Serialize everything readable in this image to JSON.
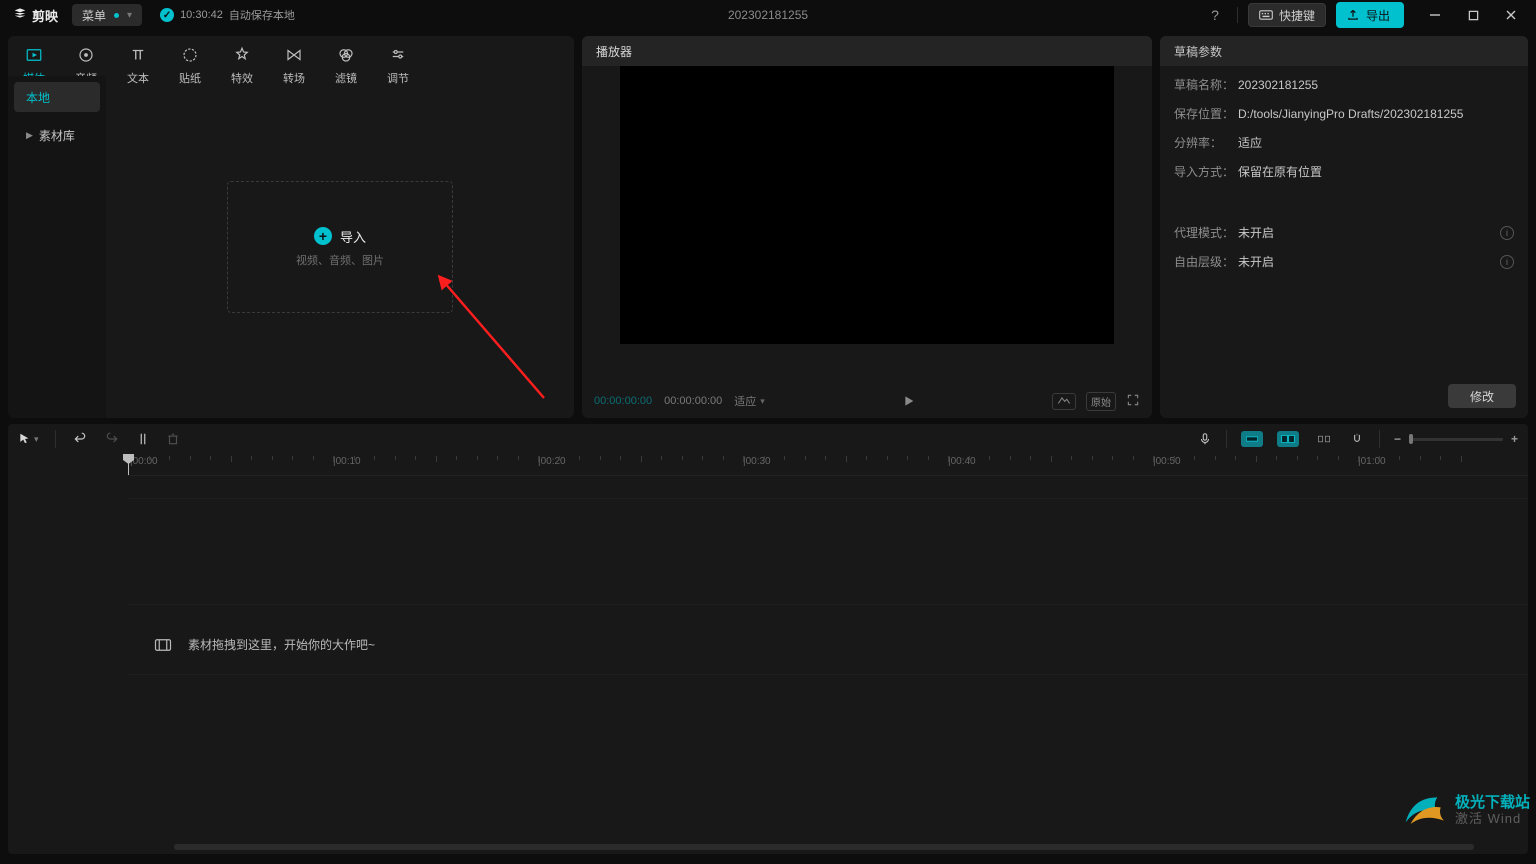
{
  "titlebar": {
    "logo": "剪映",
    "menu": "菜单",
    "autosave_time": "10:30:42",
    "autosave_text": "自动保存本地",
    "project": "202302181255",
    "shortcut": "快捷键",
    "export": "导出"
  },
  "media_tabs": [
    {
      "id": "media",
      "label": "媒体",
      "active": true
    },
    {
      "id": "audio",
      "label": "音频"
    },
    {
      "id": "text",
      "label": "文本"
    },
    {
      "id": "sticker",
      "label": "贴纸"
    },
    {
      "id": "effect",
      "label": "特效"
    },
    {
      "id": "transition",
      "label": "转场"
    },
    {
      "id": "filter",
      "label": "滤镜"
    },
    {
      "id": "adjust",
      "label": "调节"
    }
  ],
  "media_side": {
    "local": "本地",
    "library": "素材库"
  },
  "dropzone": {
    "title": "导入",
    "sub": "视频、音频、图片"
  },
  "player": {
    "title": "播放器",
    "tc1": "00:00:00:00",
    "tc2": "00:00:00:00",
    "ratio": "适应"
  },
  "draft": {
    "title": "草稿参数",
    "rows": {
      "name_k": "草稿名称：",
      "name_v": "202302181255",
      "path_k": "保存位置：",
      "path_v": "D:/tools/JianyingPro Drafts/202302181255",
      "res_k": "分辨率：",
      "res_v": "适应",
      "imp_k": "导入方式：",
      "imp_v": "保留在原有位置",
      "proxy_k": "代理模式：",
      "proxy_v": "未开启",
      "layer_k": "自由层级：",
      "layer_v": "未开启"
    },
    "modify": "修改"
  },
  "ruler": [
    "|00:00",
    "|00:10",
    "|00:20",
    "|00:30",
    "|00:40",
    "|00:50",
    "|01:00"
  ],
  "timeline": {
    "hint": "素材拖拽到这里，开始你的大作吧~"
  },
  "watermark": {
    "line1": "极光下载站",
    "line2": "激活 Wind"
  }
}
